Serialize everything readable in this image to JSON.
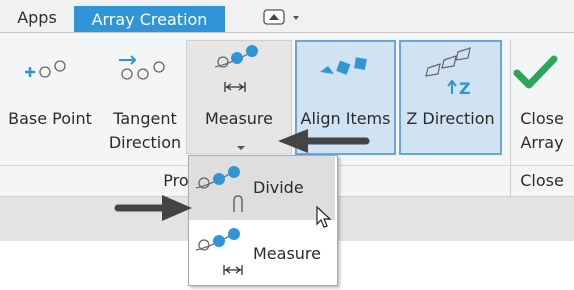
{
  "tabs": {
    "apps": "Apps",
    "array_creation": "Array Creation"
  },
  "ribbon": {
    "base_point": "Base Point",
    "tangent_direction_line1": "Tangent",
    "tangent_direction_line2": "Direction",
    "measure": "Measure",
    "align_items": "Align Items",
    "z_direction": "Z Direction",
    "close_array_line1": "Close",
    "close_array_line2": "Array"
  },
  "groups": {
    "properties": "Pro",
    "close": "Close"
  },
  "dropdown": {
    "divide": "Divide",
    "measure": "Measure"
  },
  "colors": {
    "accent": "#2f95d6",
    "checkmark": "#2aa65a",
    "selected_bg": "#cfe3f3"
  },
  "icons": [
    "base-point-icon",
    "tangent-direction-icon",
    "measure-icon",
    "align-items-icon",
    "z-direction-icon",
    "checkmark-icon",
    "arrow-pointer-icon",
    "mouse-cursor-icon",
    "divide-icon",
    "quick-access-icon"
  ]
}
